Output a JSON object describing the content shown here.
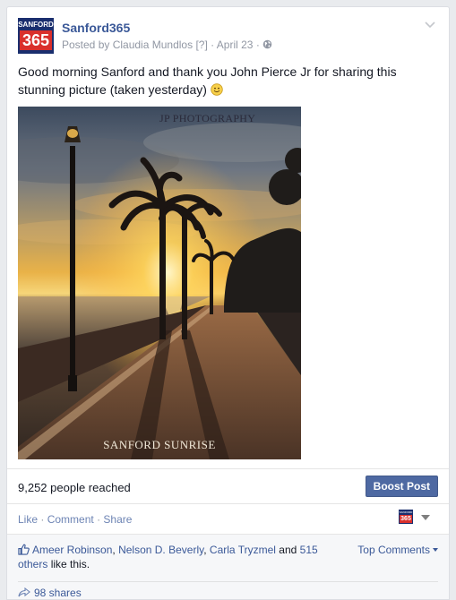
{
  "post": {
    "page_name": "Sanford365",
    "logo_top": "SANFORD",
    "logo_num": "365",
    "posted_by": "Posted by Claudia Mundlos",
    "help": "[?]",
    "date": "April 23",
    "separator": "·",
    "message": "Good morning Sanford and thank you John Pierce Jr for sharing this stunning picture (taken yesterday)",
    "photo_watermark_top": "JP PHOTOGRAPHY",
    "photo_watermark_bottom": "SANFORD SUNRISE"
  },
  "reach": {
    "text": "9,252 people reached",
    "boost_label": "Boost Post"
  },
  "actions": {
    "like": "Like",
    "comment": "Comment",
    "share": "Share",
    "dot": "·"
  },
  "likes": {
    "name1": "Ameer Robinson",
    "comma": ",",
    "name2": "Nelson D. Beverly",
    "name3": "Carla Tryzmel",
    "and": "and",
    "others": "515 others",
    "suffix": "like this.",
    "top_comments": "Top Comments"
  },
  "shares": {
    "label": "98 shares"
  },
  "colors": {
    "brand_blue": "#3b5998",
    "boost_bg": "#4e69a2",
    "logo_navy": "#1a2e6e",
    "logo_red": "#d9302c"
  },
  "icons": [
    "globe-icon",
    "chevron-down-icon",
    "smiley-icon",
    "like-thumb-icon",
    "share-arrow-icon",
    "page-avatar-icon"
  ]
}
